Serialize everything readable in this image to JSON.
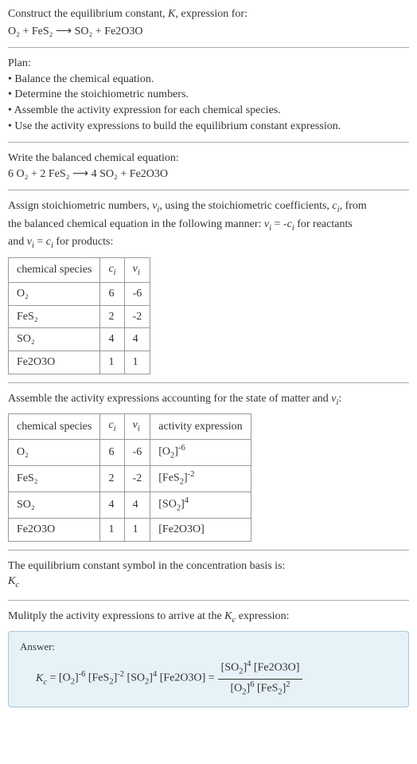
{
  "s1": {
    "line1": "Construct the equilibrium constant, K, expression for:",
    "eqn": "O₂ + FeS₂  ⟶  SO₂ + Fe2O3O"
  },
  "s2": {
    "title": "Plan:",
    "b1": "• Balance the chemical equation.",
    "b2": "• Determine the stoichiometric numbers.",
    "b3": "• Assemble the activity expression for each chemical species.",
    "b4": "• Use the activity expressions to build the equilibrium constant expression."
  },
  "s3": {
    "title": "Write the balanced chemical equation:",
    "eqn": "6 O₂ + 2 FeS₂  ⟶  4 SO₂ + Fe2O3O"
  },
  "s4": {
    "intro1": "Assign stoichiometric numbers, νᵢ, using the stoichiometric coefficients, cᵢ, from",
    "intro2": "the balanced chemical equation in the following manner: νᵢ = -cᵢ for reactants",
    "intro3": "and νᵢ = cᵢ for products:",
    "h1": "chemical species",
    "h2": "cᵢ",
    "h3": "νᵢ",
    "r1c1": "O₂",
    "r1c2": "6",
    "r1c3": "-6",
    "r2c1": "FeS₂",
    "r2c2": "2",
    "r2c3": "-2",
    "r3c1": "SO₂",
    "r3c2": "4",
    "r3c3": "4",
    "r4c1": "Fe2O3O",
    "r4c2": "1",
    "r4c3": "1"
  },
  "s5": {
    "intro": "Assemble the activity expressions accounting for the state of matter and νᵢ:",
    "h1": "chemical species",
    "h2": "cᵢ",
    "h3": "νᵢ",
    "h4": "activity expression",
    "r1c1": "O₂",
    "r1c2": "6",
    "r1c3": "-6",
    "r2c1": "FeS₂",
    "r2c2": "2",
    "r2c3": "-2",
    "r3c1": "SO₂",
    "r3c2": "4",
    "r3c3": "4",
    "r4c1": "Fe2O3O",
    "r4c2": "1",
    "r4c3": "1",
    "r4c4": "[Fe2O3O]"
  },
  "s6": {
    "line1": "The equilibrium constant symbol in the concentration basis is:",
    "sym": "K꜀"
  },
  "s7": {
    "intro": "Mulitply the activity expressions to arrive at the K꜀ expression:",
    "answer": "Answer:"
  }
}
